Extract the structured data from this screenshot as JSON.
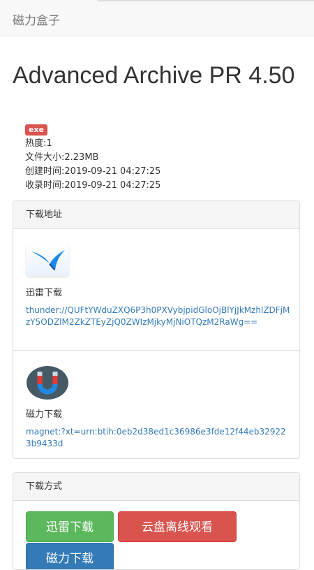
{
  "navbar": {
    "brand": "磁力盒子"
  },
  "page": {
    "title": "Advanced Archive PR 4.50",
    "badge": "exe",
    "heat": "热度:1",
    "size": "文件大小:2.23MB",
    "created": "创建时间:2019-09-21 04:27:25",
    "indexed": "收录时间:2019-09-21 04:27:25"
  },
  "download_panel": {
    "heading": "下载地址",
    "thunder": {
      "icon": "thunder-bird-icon",
      "label": "迅雷下载",
      "link": "thunder://QUFtYWduZXQ6P3h0PXVybjpidGloOjBlYjJkMzhlZDFjMzY5ODZlM2ZkZTEyZjQ0ZWIzMjkyMjNiOTQzM2RaWg=="
    },
    "magnet": {
      "icon": "magnet-icon",
      "label": "磁力下载",
      "link": "magnet:?xt=urn:btih:0eb2d38ed1c36986e3fde12f44eb329223b9433d"
    }
  },
  "method_panel": {
    "heading": "下载方式",
    "buttons": {
      "thunder": "迅雷下载",
      "cloud": "云盘离线观看",
      "magnet": "磁力下载"
    }
  },
  "colors": {
    "success": "#5cb85c",
    "danger": "#d9534f",
    "primary": "#337ab7"
  }
}
